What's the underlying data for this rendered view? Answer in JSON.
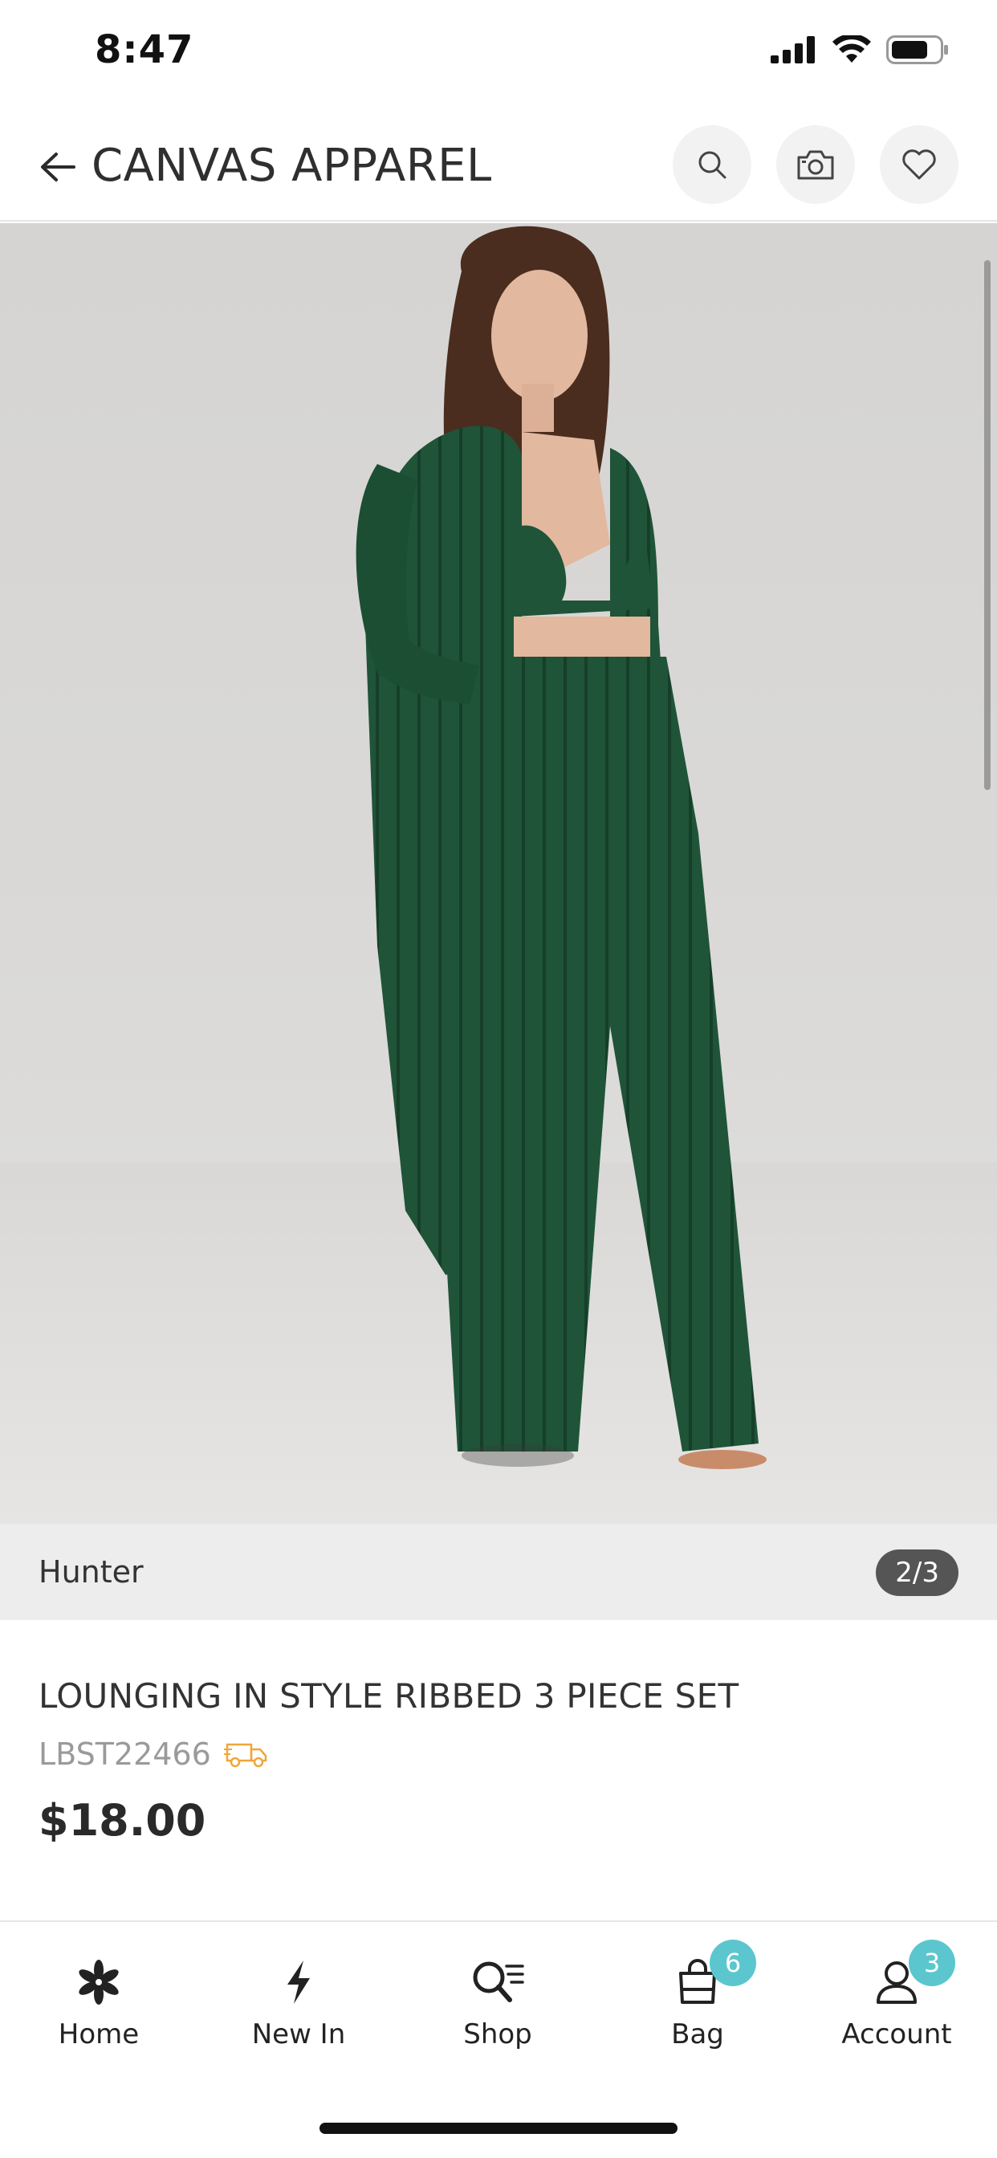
{
  "status_bar": {
    "time": "8:47"
  },
  "header": {
    "title": "CANVAS APPAREL"
  },
  "gallery": {
    "color_name": "Hunter",
    "counter": "2/3",
    "image_alt": "Model wearing green ribbed three piece set"
  },
  "product": {
    "title": "LOUNGING IN STYLE RIBBED 3 PIECE SET",
    "sku": "LBST22466",
    "price": "$18.00"
  },
  "nav": {
    "items": [
      {
        "label": "Home",
        "icon": "flower-icon"
      },
      {
        "label": "New In",
        "icon": "lightning-icon"
      },
      {
        "label": "Shop",
        "icon": "search-list-icon"
      },
      {
        "label": "Bag",
        "icon": "bag-icon",
        "badge": "6"
      },
      {
        "label": "Account",
        "icon": "user-icon",
        "badge": "3"
      }
    ]
  },
  "colors": {
    "accent_badge": "#5cc6cf",
    "garment": "#1f5438",
    "truck": "#f0a63a"
  }
}
